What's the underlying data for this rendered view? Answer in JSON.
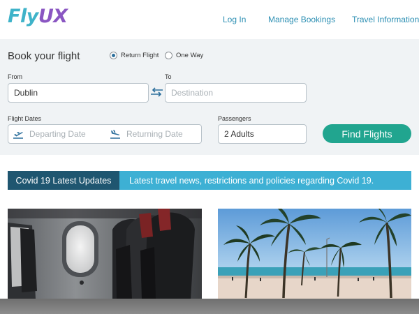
{
  "brand": {
    "logo_part1": "Fly",
    "logo_part2": "UX",
    "colors": {
      "primary": "#3fb3c9",
      "accent": "#8a56c2",
      "button": "#21a58f",
      "banner_dark": "#1f5670",
      "banner_light": "#3db0d4"
    }
  },
  "nav": {
    "login": "Log In",
    "manage": "Manage Bookings",
    "info": "Travel Information"
  },
  "booking": {
    "title": "Book your flight",
    "trip_type": {
      "return_label": "Return Flight",
      "oneway_label": "One Way",
      "selected": "Return Flight"
    },
    "from": {
      "label": "From",
      "value": "Dublin"
    },
    "to": {
      "label": "To",
      "placeholder": "Destination"
    },
    "dates": {
      "label": "Flight Dates",
      "departing_placeholder": "Departing Date",
      "returning_placeholder": "Returning Date"
    },
    "passengers": {
      "label": "Passengers",
      "value": "2 Adults"
    },
    "submit_label": "Find Flights",
    "icons": {
      "swap": "swap-arrows-icon",
      "departing": "plane-takeoff-icon",
      "returning": "plane-landing-icon"
    }
  },
  "covid": {
    "tag": "Covid 19 Latest Updates",
    "text": "Latest travel news, restrictions and policies regarding Covid 19."
  },
  "images": [
    {
      "name": "airplane-cabin-image"
    },
    {
      "name": "beach-palm-trees-image"
    }
  ]
}
